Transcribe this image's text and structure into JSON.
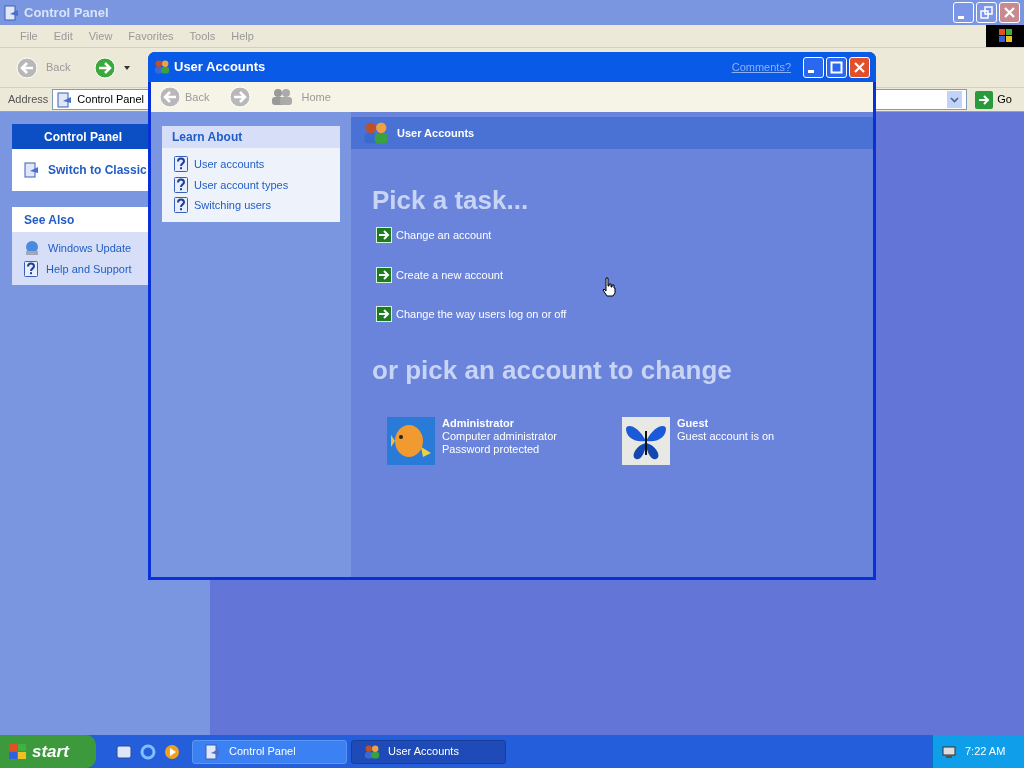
{
  "background_window": {
    "title": "Control Panel",
    "menu": [
      "File",
      "Edit",
      "View",
      "Favorites",
      "Tools",
      "Help"
    ],
    "toolbar": {
      "back": "Back"
    },
    "address": {
      "label": "Address",
      "value": "Control Panel",
      "go": "Go"
    },
    "sidebar": [
      {
        "title": "Control Panel",
        "kind": "main",
        "items": [
          {
            "label": "Switch to Classic",
            "kind": "switch"
          }
        ]
      },
      {
        "title": "See Also",
        "kind": "plain",
        "items": [
          {
            "label": "Windows Update",
            "kind": "update"
          },
          {
            "label": "Help and Support",
            "kind": "help"
          }
        ]
      }
    ]
  },
  "window": {
    "title": "User Accounts",
    "comments": "Comments?",
    "nav": {
      "back": "Back",
      "home": "Home"
    },
    "learn_about": {
      "title": "Learn About",
      "items": [
        "User accounts",
        "User account types",
        "Switching users"
      ]
    },
    "header": "User Accounts",
    "heading": "Pick a task...",
    "tasks": [
      "Change an account",
      "Create a new account",
      "Change the way users log on or off"
    ],
    "accounts_heading": "or pick an account to change",
    "accounts": [
      {
        "name": "Administrator",
        "kind": "fish",
        "lines": [
          "Computer administrator",
          "Password protected"
        ]
      },
      {
        "name": "Guest",
        "kind": "butterfly",
        "lines": [
          "Guest account is on"
        ]
      }
    ]
  },
  "taskbar": {
    "start": "start",
    "tasks": [
      {
        "label": "Control Panel",
        "kind": "panel",
        "selected": false
      },
      {
        "label": "User Accounts",
        "kind": "users",
        "selected": true
      }
    ],
    "clock": "7:22 AM"
  }
}
